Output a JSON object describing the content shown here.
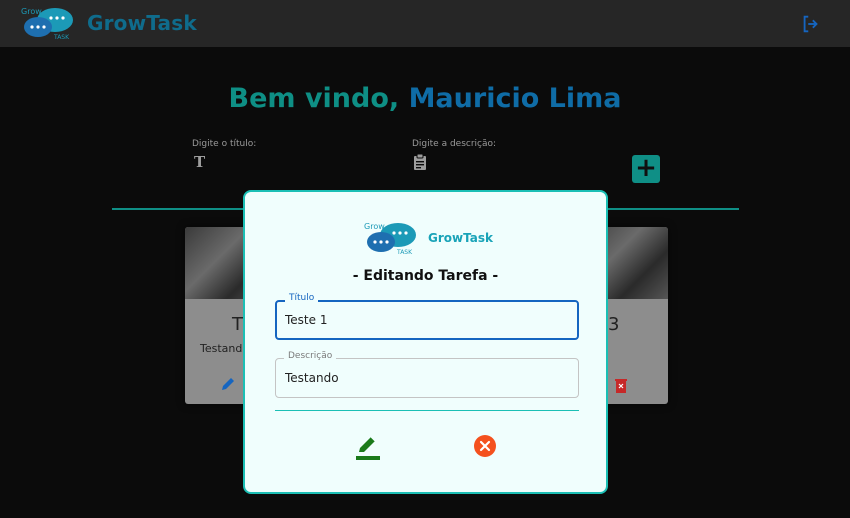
{
  "header": {
    "brand": "GrowTask",
    "logo_text_top": "Grow",
    "logo_text_bottom": "TASK",
    "logout_icon": "logout-icon"
  },
  "welcome": {
    "greeting": "Bem vindo, ",
    "user_name": "Mauricio Lima"
  },
  "form": {
    "title_label": "Digite o título:",
    "desc_label": "Digite a descrição:",
    "title_icon": "T",
    "add_label": "+"
  },
  "cards": [
    {
      "title_partial": "T",
      "desc_partial": "Testando"
    },
    {
      "title_partial": "3"
    }
  ],
  "modal": {
    "brand": "GrowTask",
    "heading": "- Editando Tarefa -",
    "title_legend": "Título",
    "title_value": "Teste 1",
    "desc_legend": "Descrição",
    "desc_value": "Testando"
  },
  "colors": {
    "accent": "#0f8f86",
    "brand": "#0f6c8c",
    "edit_green": "#1a7a1a",
    "cancel_orange": "#f4511e",
    "focus_blue": "#1565c0"
  }
}
